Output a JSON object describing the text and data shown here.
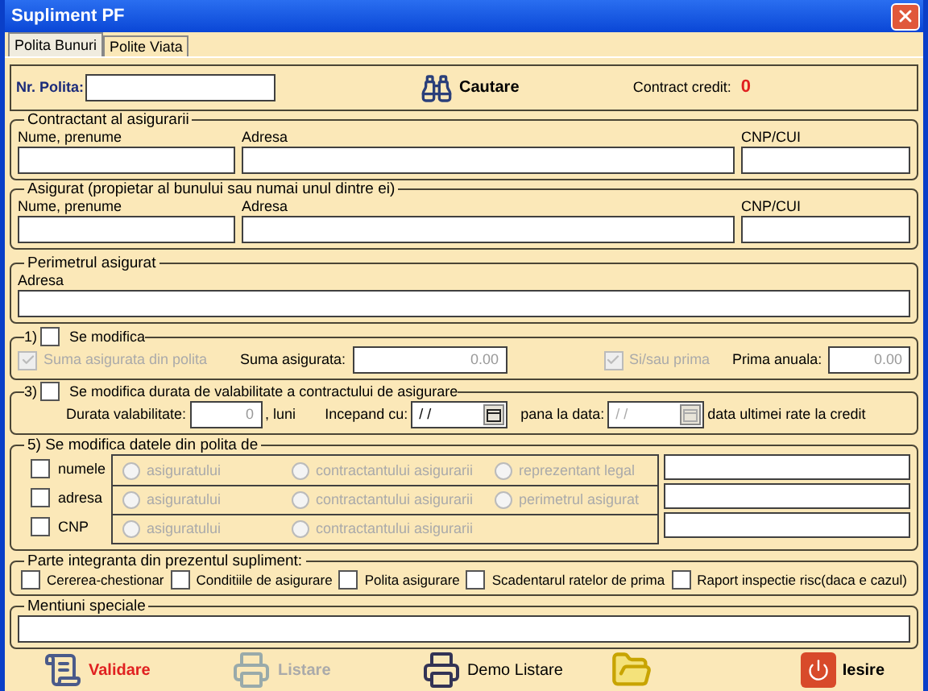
{
  "window": {
    "title": "Supliment PF"
  },
  "tabs": [
    {
      "label": "Polita Bunuri",
      "selected": true
    },
    {
      "label": "Polite Viata",
      "selected": false
    }
  ],
  "policy": {
    "label": "Nr. Polita:",
    "search_button": "Cautare",
    "credit_label": "Contract credit:",
    "credit_value": "0"
  },
  "parties": [
    {
      "legend": "Contractant al asigurarii",
      "fields": [
        "Nume, prenume",
        "Adresa",
        "CNP/CUI"
      ]
    },
    {
      "legend": "Asigurat (propietar al bunului sau numai unul dintre ei)",
      "fields": [
        "Nume, prenume",
        "Adresa",
        "CNP/CUI"
      ]
    }
  ],
  "perimeter": {
    "legend": "Perimetrul asigurat",
    "field": "Adresa"
  },
  "section1": {
    "number": "1)",
    "checked": false,
    "legend": "Se modifica",
    "sum_check": {
      "label": "Suma asigurata din polita",
      "checked": true,
      "disabled": true
    },
    "sum_label": "Suma asigurata:",
    "sum_value": "0.00",
    "premium_check": {
      "label": "Si/sau prima",
      "checked": true,
      "disabled": true
    },
    "premium_label": "Prima anuala:",
    "premium_value": "0.00"
  },
  "section3": {
    "number": "3)",
    "checked": false,
    "legend": "Se modifica durata de valabilitate a contractului de asigurare",
    "duration_label": "Durata valabilitate:",
    "duration_value": "0",
    "duration_unit": ", luni",
    "start_label": "Incepand cu:",
    "start_value": "/ /",
    "end_label": "pana la data:",
    "end_value": "/ /",
    "note": "data ultimei rate la credit"
  },
  "section5": {
    "legend": "5)  Se modifica datele din polita de",
    "rows": [
      {
        "label": "numele",
        "checked": false,
        "options": [
          {
            "label": "asiguratului",
            "selected": false
          },
          {
            "label": "contractantului asigurarii",
            "selected": false
          },
          {
            "label": "reprezentant legal",
            "selected": false
          }
        ]
      },
      {
        "label": "adresa",
        "checked": false,
        "options": [
          {
            "label": "asiguratului",
            "selected": false
          },
          {
            "label": "contractantului asigurarii",
            "selected": false
          },
          {
            "label": "perimetrul asigurat",
            "selected": false
          }
        ]
      },
      {
        "label": "CNP",
        "checked": false,
        "options": [
          {
            "label": "asiguratului",
            "selected": false
          },
          {
            "label": "contractantului asigurarii",
            "selected": false
          }
        ]
      }
    ]
  },
  "annexes": {
    "legend": "Parte integranta din prezentul supliment:",
    "items": [
      {
        "label": "Cererea-chestionar",
        "checked": false
      },
      {
        "label": "Conditiile de asigurare",
        "checked": false
      },
      {
        "label": "Polita asigurare",
        "checked": false
      },
      {
        "label": "Scadentarul ratelor de prima",
        "checked": false
      },
      {
        "label": "Raport inspectie risc(daca e cazul)",
        "checked": false
      }
    ]
  },
  "notes": {
    "legend": "Mentiuni speciale"
  },
  "actions": [
    {
      "kind": "validate",
      "label": "Validare",
      "disabled": false
    },
    {
      "kind": "print",
      "label": "Listare",
      "disabled": true
    },
    {
      "kind": "print",
      "label": "Demo Listare",
      "disabled": false
    },
    {
      "kind": "folder"
    },
    {
      "kind": "exit",
      "label": "Iesire",
      "disabled": false
    }
  ]
}
